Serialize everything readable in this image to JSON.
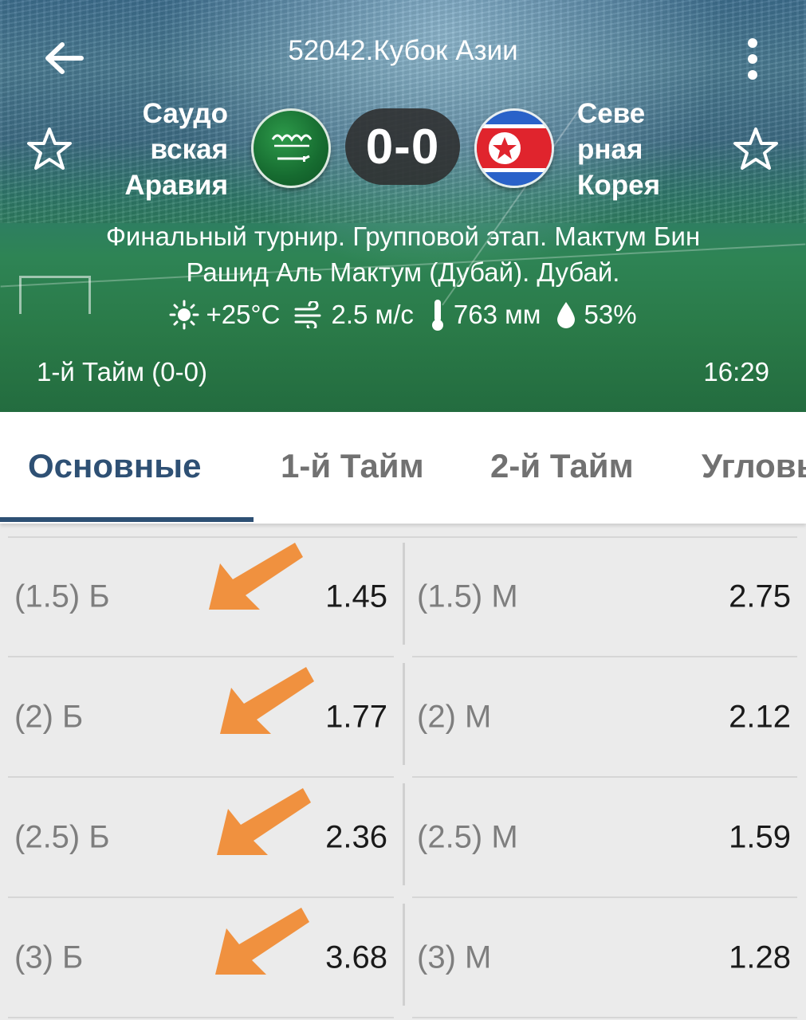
{
  "header": {
    "title": "52042.Кубок Азии",
    "home_team": {
      "name_lines": [
        "Саудо",
        "вская",
        "Аравия"
      ],
      "flag": "saudi-arabia-flag"
    },
    "away_team": {
      "name_lines": [
        "Севе",
        "рная",
        "Корея"
      ],
      "flag": "north-korea-flag"
    },
    "score": "0-0",
    "venue_lines": [
      "Финальный турнир. Групповой этап. Мактум Бин",
      "Рашид Аль Мактум (Дубай). Дубай."
    ],
    "weather": {
      "temperature": "+25°C",
      "wind": "2.5 м/с",
      "pressure": "763 мм",
      "humidity": "53%"
    },
    "period": "1-й  Тайм (0-0)",
    "clock": "16:29"
  },
  "tabs": [
    {
      "label": "Основные",
      "active": true
    },
    {
      "label": "1-й  Тайм",
      "active": false
    },
    {
      "label": "2-й  Тайм",
      "active": false
    },
    {
      "label": "Угловые",
      "active": false
    }
  ],
  "odds": [
    {
      "over_label": "(1.5) Б",
      "over_odds": "1.45",
      "under_label": "(1.5) М",
      "under_odds": "2.75"
    },
    {
      "over_label": "(2) Б",
      "over_odds": "1.77",
      "under_label": "(2) М",
      "under_odds": "2.12"
    },
    {
      "over_label": "(2.5) Б",
      "over_odds": "2.36",
      "under_label": "(2.5) М",
      "under_odds": "1.59"
    },
    {
      "over_label": "(3) Б",
      "over_odds": "3.68",
      "under_label": "(3) М",
      "under_odds": "1.28"
    }
  ],
  "colors": {
    "accent": "#2e5074",
    "annotation_arrow": "#f0913f",
    "tab_inactive": "#717171"
  }
}
